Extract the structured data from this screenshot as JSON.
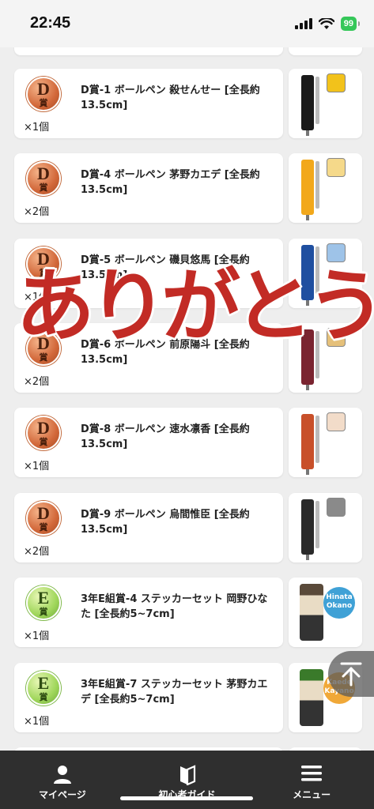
{
  "status_bar": {
    "time": "22:45",
    "battery": "99"
  },
  "items": [
    {
      "badge_letter": "D",
      "badge_kanji": "賞",
      "title": "D賞-1 ボールペン 殺せんせー [全長約13.5cm]",
      "qty": "×1個",
      "pen_color": "#1a1a1a",
      "accent": "#f2c21b"
    },
    {
      "badge_letter": "D",
      "badge_kanji": "賞",
      "title": "D賞-4 ボールペン 茅野カエデ [全長約13.5cm]",
      "qty": "×2個",
      "pen_color": "#f2a81b",
      "accent": "#f5d98a"
    },
    {
      "badge_letter": "D",
      "badge_kanji": "賞",
      "title": "D賞-5 ボールペン 磯貝悠馬 [全長約13.5cm]",
      "qty": "×1個",
      "pen_color": "#1f4fa0",
      "accent": "#9ec3e8"
    },
    {
      "badge_letter": "D",
      "badge_kanji": "賞",
      "title": "D賞-6 ボールペン 前原陽斗 [全長約13.5cm]",
      "qty": "×2個",
      "pen_color": "#7a2430",
      "accent": "#e5c07a"
    },
    {
      "badge_letter": "D",
      "badge_kanji": "賞",
      "title": "D賞-8 ボールペン 速水凛香 [全長約13.5cm]",
      "qty": "×1個",
      "pen_color": "#c8502a",
      "accent": "#f2dcc9"
    },
    {
      "badge_letter": "D",
      "badge_kanji": "賞",
      "title": "D賞-9 ボールペン 烏間惟臣 [全長約13.5cm]",
      "qty": "×2個",
      "pen_color": "#2a2a2a",
      "accent": "#8a8a8a"
    },
    {
      "badge_letter": "E",
      "badge_kanji": "賞",
      "title": "3年E組賞-4 ステッカーセット 岡野ひなた [全長約5~7cm]",
      "qty": "×1個",
      "sticker_logo": "Hinata Okano"
    },
    {
      "badge_letter": "E",
      "badge_kanji": "賞",
      "title": "3年E組賞-7 ステッカーセット 茅野カエデ [全長約5~7cm]",
      "qty": "×1個",
      "sticker_logo": "Kaede Kayano"
    }
  ],
  "overlay": {
    "text": "ありがとう",
    "color": "#c22b25"
  },
  "tab_bar": {
    "tabs": [
      {
        "label": "マイページ",
        "icon": "person-icon"
      },
      {
        "label": "初心者ガイド",
        "icon": "book-icon"
      },
      {
        "label": "メニュー",
        "icon": "hamburger-icon"
      }
    ]
  }
}
